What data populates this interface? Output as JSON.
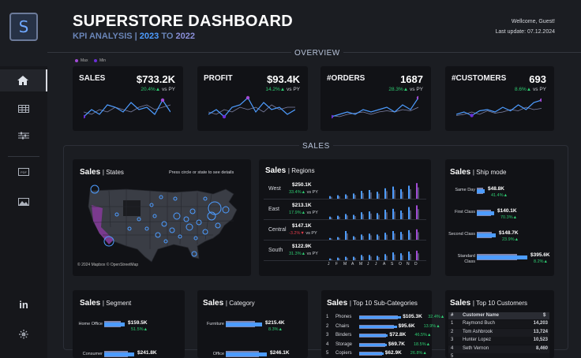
{
  "header": {
    "logo_letter": "S",
    "title": "SUPERSTORE DASHBOARD",
    "subtitle_prefix": "KPI ANALYSIS | ",
    "year_current": "2023",
    "to": " TO ",
    "year_previous": "2022",
    "welcome": "Wellcome,  Guest!",
    "last_update": "Last update: 07.12.2024"
  },
  "sidebar": {
    "items": [
      "home-icon",
      "table-icon",
      "filter-icon",
      "pdf-icon",
      "image-icon"
    ],
    "footer": [
      "linkedin-icon",
      "tableau-icon"
    ],
    "pdf_label": "PDF"
  },
  "overview": {
    "title": "OVERVIEW",
    "legend_max": "Max",
    "legend_min": "Min",
    "kpis": [
      {
        "label": "SALES",
        "value": "$733.2K",
        "pct": "20.4%",
        "arrow": "▲",
        "vs": " vs PY"
      },
      {
        "label": "PROFIT",
        "value": "$93.4K",
        "pct": "14.2%",
        "arrow": "▲",
        "vs": " vs PY"
      },
      {
        "label": "#ORDERS",
        "value": "1687",
        "pct": "28.3%",
        "arrow": "▲",
        "vs": " vs PY"
      },
      {
        "label": "#CUSTOMERS",
        "value": "693",
        "pct": "8.6%",
        "arrow": "▲",
        "vs": " vs PY"
      }
    ]
  },
  "sales": {
    "title": "SALES",
    "states": {
      "title": "Sales",
      "sub": "| States",
      "hint": "Press circle or state to see details",
      "credit": "© 2024 Mapbox  © OpenStreetMap"
    },
    "regions": {
      "title": "Sales",
      "sub": "| Regions",
      "rows": [
        {
          "name": "West",
          "value": "$250.1K",
          "pct": "33.4%",
          "arrow": "▲",
          "dir": "up",
          "vs": " vs PY"
        },
        {
          "name": "East",
          "value": "$213.1K",
          "pct": "17.9%",
          "arrow": "▲",
          "dir": "up",
          "vs": " vs PY"
        },
        {
          "name": "Central",
          "value": "$147.1K",
          "pct": "-3.2%",
          "arrow": "▼",
          "dir": "dn",
          "vs": " vs PY"
        },
        {
          "name": "South",
          "value": "$122.9K",
          "pct": "31.3%",
          "arrow": "▲",
          "dir": "up",
          "vs": " vs PY"
        }
      ],
      "months": [
        "J",
        "F",
        "M",
        "A",
        "M",
        "J",
        "J",
        "A",
        "S",
        "O",
        "N",
        "D"
      ]
    },
    "shipmode": {
      "title": "Sales",
      "sub": "| Ship mode",
      "rows": [
        {
          "name": "Same Day",
          "value": "$48.8K",
          "pct": "41.4%",
          "arrow": "▲"
        },
        {
          "name": "First Class",
          "value": "$140.1K",
          "pct": "70.3%",
          "arrow": "▲"
        },
        {
          "name": "Second Class",
          "value": "$148.7K",
          "pct": "23.9%",
          "arrow": "▲"
        },
        {
          "name": "Standard Class",
          "value": "$395.6K",
          "pct": "8.2%",
          "arrow": "▲"
        }
      ]
    },
    "segment": {
      "title": "Sales",
      "sub": "| Segment",
      "rows": [
        {
          "name": "Home Office",
          "value": "$159.5K",
          "pct": "51.5%",
          "arrow": "▲"
        },
        {
          "name": "Consumer",
          "value": "$241.8K",
          "pct": "",
          "arrow": ""
        }
      ]
    },
    "category": {
      "title": "Sales",
      "sub": "| Category",
      "rows": [
        {
          "name": "Furniture",
          "value": "$215.4K",
          "pct": "8.3%",
          "arrow": "▲"
        },
        {
          "name": "Office",
          "value": "$246.1K",
          "pct": "",
          "arrow": ""
        }
      ]
    },
    "subcats": {
      "title": "Sales",
      "sub": "| Top 10  Sub-Categories",
      "rows": [
        {
          "rank": "1",
          "name": "Phones",
          "value": "$105.3K",
          "pct": "32.4%",
          "arrow": "▲"
        },
        {
          "rank": "2",
          "name": "Chairs",
          "value": "$95.6K",
          "pct": "13.9%",
          "arrow": "▲"
        },
        {
          "rank": "3",
          "name": "Binders",
          "value": "$72.8K",
          "pct": "46.5%",
          "arrow": "▲"
        },
        {
          "rank": "4",
          "name": "Storage",
          "value": "$69.7K",
          "pct": "18.5%",
          "arrow": "▲"
        },
        {
          "rank": "5",
          "name": "Copiers",
          "value": "$62.9K",
          "pct": "26.8%",
          "arrow": "▲"
        }
      ]
    },
    "customers": {
      "title": "Sales",
      "sub": "| Top 10 Customers",
      "col_rank": "#",
      "col_name": "Customer Name",
      "col_val": "$",
      "rows": [
        {
          "rank": "1",
          "name": "Raymond Buch",
          "value": "14,203"
        },
        {
          "rank": "2",
          "name": "Tom Ashbrook",
          "value": "13,724"
        },
        {
          "rank": "3",
          "name": "Hunter Lopez",
          "value": "10,523"
        },
        {
          "rank": "4",
          "name": "Seth Vernon",
          "value": "8,460"
        },
        {
          "rank": "5",
          "name": "",
          "value": ""
        }
      ]
    }
  },
  "colors": {
    "current": "#4d9cff",
    "previous": "#7f83a8",
    "max": "#a24bd6",
    "min": "#6a2ed8",
    "up": "#2ecc71",
    "down": "#e23b4a",
    "panel": "#111216"
  }
}
